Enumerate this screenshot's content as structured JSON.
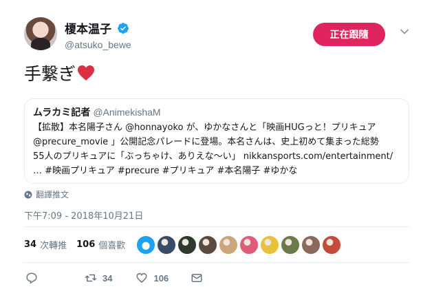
{
  "author": {
    "display_name": "榎本温子",
    "handle": "@atsuko_bewe",
    "verified": true
  },
  "follow_button": {
    "label": "正在跟隨"
  },
  "tweet": {
    "text": "手繋ぎ",
    "emoji": "red-heart"
  },
  "quote": {
    "author_name": "ムラカミ記者",
    "author_handle": "@AnimekishaM",
    "body": "【拡散】本名陽子さん @honnayoko が、ゆかなさんと「映画HUGっと！プリキュア\n@precure_movie 」公開記念パレードに登場。本名さんは、史上初めて集まった総勢\n55人のプリキュアに「ぶっちゃけ、ありえな〜い」 nikkansports.com/entertainment/\n… #映画プリキュア #precure  #プリキュア #本名陽子 #ゆかな"
  },
  "translate_label": "翻譯推文",
  "timestamp": "下午7:09 - 2018年10月21日",
  "stats": {
    "retweets_count": "34",
    "retweets_label": "次轉推",
    "likes_count": "106",
    "likes_label": "個喜歡"
  },
  "likers": [
    {
      "color": "#1da1f2"
    },
    {
      "color": "#3a4a6b"
    },
    {
      "color": "#2f3a2f"
    },
    {
      "color": "#5a4a40"
    },
    {
      "color": "#c9a77a"
    },
    {
      "color": "#e05a7a"
    },
    {
      "color": "#e8c23a"
    },
    {
      "color": "#6a7a4a"
    },
    {
      "color": "#8a6a5a"
    },
    {
      "color": "#c44a3a"
    }
  ],
  "actions": {
    "reply_count": "",
    "retweet_count": "34",
    "like_count": "106"
  },
  "colors": {
    "accent": "#e0245e",
    "verified": "#1da1f2",
    "heart": "#e0245e",
    "muted": "#657786"
  }
}
